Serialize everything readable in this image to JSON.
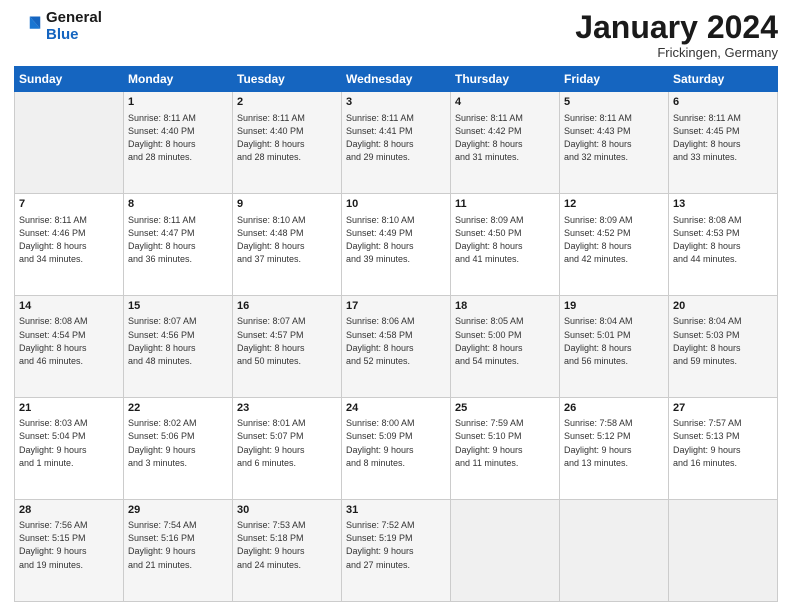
{
  "header": {
    "logo_general": "General",
    "logo_blue": "Blue",
    "month_title": "January 2024",
    "location": "Frickingen, Germany"
  },
  "weekdays": [
    "Sunday",
    "Monday",
    "Tuesday",
    "Wednesday",
    "Thursday",
    "Friday",
    "Saturday"
  ],
  "weeks": [
    [
      {
        "day": "",
        "info": ""
      },
      {
        "day": "1",
        "info": "Sunrise: 8:11 AM\nSunset: 4:40 PM\nDaylight: 8 hours\nand 28 minutes."
      },
      {
        "day": "2",
        "info": "Sunrise: 8:11 AM\nSunset: 4:40 PM\nDaylight: 8 hours\nand 28 minutes."
      },
      {
        "day": "3",
        "info": "Sunrise: 8:11 AM\nSunset: 4:41 PM\nDaylight: 8 hours\nand 29 minutes."
      },
      {
        "day": "4",
        "info": "Sunrise: 8:11 AM\nSunset: 4:42 PM\nDaylight: 8 hours\nand 31 minutes."
      },
      {
        "day": "5",
        "info": "Sunrise: 8:11 AM\nSunset: 4:43 PM\nDaylight: 8 hours\nand 32 minutes."
      },
      {
        "day": "6",
        "info": "Sunrise: 8:11 AM\nSunset: 4:45 PM\nDaylight: 8 hours\nand 33 minutes."
      }
    ],
    [
      {
        "day": "7",
        "info": "Sunrise: 8:11 AM\nSunset: 4:46 PM\nDaylight: 8 hours\nand 34 minutes."
      },
      {
        "day": "8",
        "info": "Sunrise: 8:11 AM\nSunset: 4:47 PM\nDaylight: 8 hours\nand 36 minutes."
      },
      {
        "day": "9",
        "info": "Sunrise: 8:10 AM\nSunset: 4:48 PM\nDaylight: 8 hours\nand 37 minutes."
      },
      {
        "day": "10",
        "info": "Sunrise: 8:10 AM\nSunset: 4:49 PM\nDaylight: 8 hours\nand 39 minutes."
      },
      {
        "day": "11",
        "info": "Sunrise: 8:09 AM\nSunset: 4:50 PM\nDaylight: 8 hours\nand 41 minutes."
      },
      {
        "day": "12",
        "info": "Sunrise: 8:09 AM\nSunset: 4:52 PM\nDaylight: 8 hours\nand 42 minutes."
      },
      {
        "day": "13",
        "info": "Sunrise: 8:08 AM\nSunset: 4:53 PM\nDaylight: 8 hours\nand 44 minutes."
      }
    ],
    [
      {
        "day": "14",
        "info": "Sunrise: 8:08 AM\nSunset: 4:54 PM\nDaylight: 8 hours\nand 46 minutes."
      },
      {
        "day": "15",
        "info": "Sunrise: 8:07 AM\nSunset: 4:56 PM\nDaylight: 8 hours\nand 48 minutes."
      },
      {
        "day": "16",
        "info": "Sunrise: 8:07 AM\nSunset: 4:57 PM\nDaylight: 8 hours\nand 50 minutes."
      },
      {
        "day": "17",
        "info": "Sunrise: 8:06 AM\nSunset: 4:58 PM\nDaylight: 8 hours\nand 52 minutes."
      },
      {
        "day": "18",
        "info": "Sunrise: 8:05 AM\nSunset: 5:00 PM\nDaylight: 8 hours\nand 54 minutes."
      },
      {
        "day": "19",
        "info": "Sunrise: 8:04 AM\nSunset: 5:01 PM\nDaylight: 8 hours\nand 56 minutes."
      },
      {
        "day": "20",
        "info": "Sunrise: 8:04 AM\nSunset: 5:03 PM\nDaylight: 8 hours\nand 59 minutes."
      }
    ],
    [
      {
        "day": "21",
        "info": "Sunrise: 8:03 AM\nSunset: 5:04 PM\nDaylight: 9 hours\nand 1 minute."
      },
      {
        "day": "22",
        "info": "Sunrise: 8:02 AM\nSunset: 5:06 PM\nDaylight: 9 hours\nand 3 minutes."
      },
      {
        "day": "23",
        "info": "Sunrise: 8:01 AM\nSunset: 5:07 PM\nDaylight: 9 hours\nand 6 minutes."
      },
      {
        "day": "24",
        "info": "Sunrise: 8:00 AM\nSunset: 5:09 PM\nDaylight: 9 hours\nand 8 minutes."
      },
      {
        "day": "25",
        "info": "Sunrise: 7:59 AM\nSunset: 5:10 PM\nDaylight: 9 hours\nand 11 minutes."
      },
      {
        "day": "26",
        "info": "Sunrise: 7:58 AM\nSunset: 5:12 PM\nDaylight: 9 hours\nand 13 minutes."
      },
      {
        "day": "27",
        "info": "Sunrise: 7:57 AM\nSunset: 5:13 PM\nDaylight: 9 hours\nand 16 minutes."
      }
    ],
    [
      {
        "day": "28",
        "info": "Sunrise: 7:56 AM\nSunset: 5:15 PM\nDaylight: 9 hours\nand 19 minutes."
      },
      {
        "day": "29",
        "info": "Sunrise: 7:54 AM\nSunset: 5:16 PM\nDaylight: 9 hours\nand 21 minutes."
      },
      {
        "day": "30",
        "info": "Sunrise: 7:53 AM\nSunset: 5:18 PM\nDaylight: 9 hours\nand 24 minutes."
      },
      {
        "day": "31",
        "info": "Sunrise: 7:52 AM\nSunset: 5:19 PM\nDaylight: 9 hours\nand 27 minutes."
      },
      {
        "day": "",
        "info": ""
      },
      {
        "day": "",
        "info": ""
      },
      {
        "day": "",
        "info": ""
      }
    ]
  ]
}
